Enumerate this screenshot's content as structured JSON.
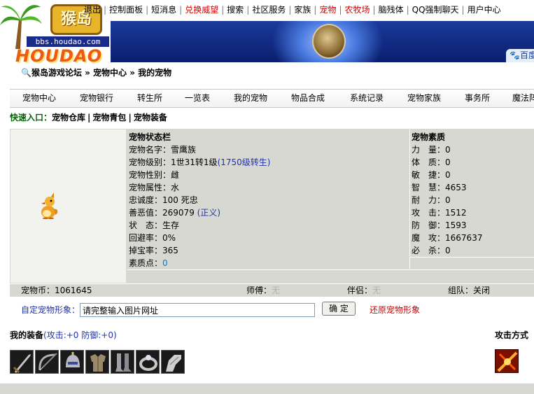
{
  "logo": {
    "text": "猴岛",
    "url": "bbs.houdao.com",
    "wordmark": "HOUDAO"
  },
  "topnav": {
    "items": [
      {
        "label": "退出",
        "color": "#000000"
      },
      {
        "label": "控制面板",
        "color": "#000000"
      },
      {
        "label": "短消息",
        "color": "#000000"
      },
      {
        "label": "兑换威望",
        "color": "#d40000"
      },
      {
        "label": "搜索",
        "color": "#000000"
      },
      {
        "label": "社区服务",
        "color": "#000000"
      },
      {
        "label": "家族",
        "color": "#000000"
      },
      {
        "label": "宠物",
        "color": "#d40000"
      },
      {
        "label": "农牧场",
        "color": "#d40000"
      },
      {
        "label": "脑残体",
        "color": "#000000"
      },
      {
        "label": "QQ强制聊天",
        "color": "#000000"
      },
      {
        "label": "用户中心",
        "color": "#000000"
      }
    ]
  },
  "banner": {
    "tab_label": "百度"
  },
  "breadcrumb": "猴岛游戏论坛 » 宠物中心 » 我的宠物",
  "mainnav": [
    "宠物中心",
    "宠物银行",
    "转生所",
    "一览表",
    "我的宠物",
    "物品合成",
    "系统记录",
    "宠物家族",
    "事务所",
    "魔法阵"
  ],
  "quicklinks": {
    "label": "快速入口：",
    "items": [
      "宠物仓库",
      "宠物青包",
      "宠物装备"
    ]
  },
  "status": {
    "title": "宠物状态栏",
    "name_label": "宠物名字：",
    "name": "雪鹰族",
    "level_label": "宠物级别：",
    "level": "1世31转1级",
    "level_extra": "(1750级转生)",
    "gender_label": "宠物性别：",
    "gender": "雌",
    "element_label": "宠物属性：",
    "element": "水",
    "loyalty_label": "忠诚度：",
    "loyalty": "100 死忠",
    "karma_label": "善恶值：",
    "karma": "269079",
    "karma_extra": "(正义)",
    "state_label": "状　态：",
    "state": "生存",
    "dodge_label": "回避率：",
    "dodge": "0%",
    "drop_label": "掉宝率：",
    "drop": "365",
    "points_label": "素质点：",
    "points": "0"
  },
  "attributes": {
    "title": "宠物素质",
    "rows": [
      {
        "label": "力　量：",
        "value": "0"
      },
      {
        "label": "体　质：",
        "value": "0"
      },
      {
        "label": "敏　捷：",
        "value": "0"
      },
      {
        "label": "智　慧：",
        "value": "4653"
      },
      {
        "label": "耐　力：",
        "value": "0"
      },
      {
        "label": "攻　击：",
        "value": "1512"
      },
      {
        "label": "防　御：",
        "value": "1593"
      },
      {
        "label": "魔　攻：",
        "value": "1667637"
      },
      {
        "label": "必　杀：",
        "value": "0"
      }
    ]
  },
  "summary": {
    "coins_label": "宠物币：",
    "coins": "1061645",
    "master_label": "师傅：",
    "master": "无",
    "partner_label": "伴侣：",
    "partner": "无",
    "team_label": "组队：",
    "team": "关闭"
  },
  "custom": {
    "label": "自定宠物形象：",
    "input_value": "请完整输入图片网址",
    "confirm_label": "确 定",
    "restore_label": "还原宠物形象"
  },
  "equipment": {
    "title": "我的装备",
    "stats": "(攻击:+0 防御:+0)",
    "slots": [
      "sword-icon",
      "bow-icon",
      "helmet-icon",
      "armor-icon",
      "boots-icon",
      "ring-icon",
      "gauntlet-icon"
    ],
    "attack_mode_label": "攻击方式",
    "attack_mode_icon": "fire-slash-icon"
  }
}
